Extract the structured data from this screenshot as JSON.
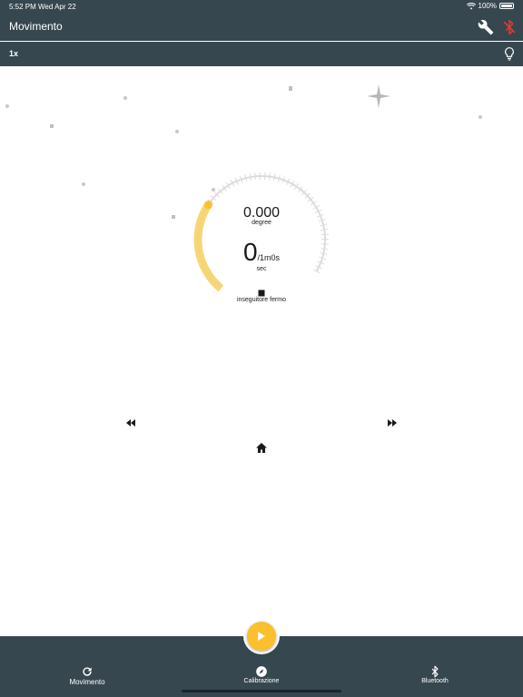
{
  "status_bar": {
    "time": "5:52 PM",
    "date": "Wed Apr 22",
    "battery": "100%",
    "icons": [
      "wifi-icon",
      "battery-icon"
    ]
  },
  "appbar": {
    "title": "Movimento",
    "icons": [
      "wrench-icon",
      "bluetooth-disabled-icon"
    ]
  },
  "subbar": {
    "speed": "1x",
    "icons": [
      "lightbulb-icon"
    ]
  },
  "dial": {
    "degree_value": "0.000",
    "degree_unit": "degree",
    "time_value": "0",
    "time_suffix": "/1m0s",
    "time_unit": "sec",
    "tracker_status": "inseguitore fermo",
    "progress_fraction": 0.32
  },
  "controls": {
    "icons": [
      "stop-icon",
      "rewind-icon",
      "fast-forward-icon",
      "home-icon",
      "play-icon"
    ]
  },
  "bottom_nav": {
    "items": [
      {
        "label": "Movimento",
        "icon": "refresh-icon"
      },
      {
        "label": "Calibrazione",
        "icon": "compass-icon"
      },
      {
        "label": "Bluetooth",
        "icon": "bluetooth-icon"
      }
    ]
  },
  "colors": {
    "bar": "#37474f",
    "accent": "#fbc02d",
    "arc_active": "#f6d36b",
    "arc_inactive": "#dcdcdc",
    "disabled_red": "#e53935"
  }
}
